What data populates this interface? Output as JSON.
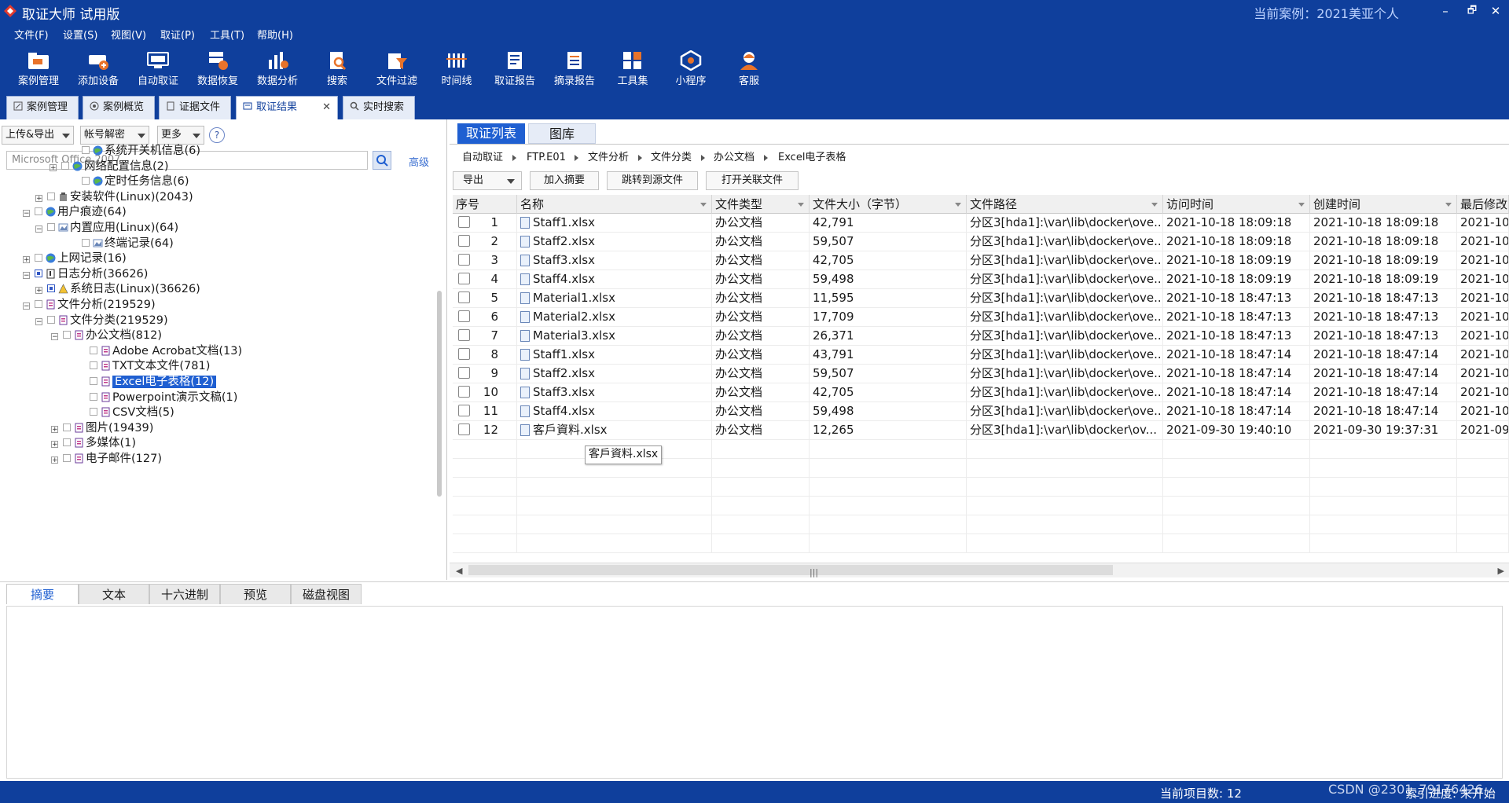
{
  "window": {
    "title": "取证大师 试用版",
    "case_label": "当前案例：2021美亚个人",
    "controls": {
      "minimize": "–",
      "restore": "🗗",
      "close": "✕"
    }
  },
  "menu": [
    "文件(F)",
    "设置(S)",
    "视图(V)",
    "取证(P)",
    "工具(T)",
    "帮助(H)"
  ],
  "toolbar": [
    {
      "label": "案例管理",
      "icon": "folder-icon"
    },
    {
      "label": "添加设备",
      "icon": "add-device-icon"
    },
    {
      "label": "自动取证",
      "icon": "auto-icon"
    },
    {
      "label": "数据恢复",
      "icon": "recover-icon"
    },
    {
      "label": "数据分析",
      "icon": "analysis-icon"
    },
    {
      "label": "搜索",
      "icon": "search-icon"
    },
    {
      "label": "文件过滤",
      "icon": "filter-icon"
    },
    {
      "label": "时间线",
      "icon": "timeline-icon"
    },
    {
      "label": "取证报告",
      "icon": "report-icon"
    },
    {
      "label": "摘录报告",
      "icon": "excerpt-report-icon"
    },
    {
      "label": "工具集",
      "icon": "toolset-icon"
    },
    {
      "label": "小程序",
      "icon": "miniapp-icon"
    },
    {
      "label": "客服",
      "icon": "support-icon"
    }
  ],
  "module_tabs": [
    {
      "label": "案例管理"
    },
    {
      "label": "案例概览"
    },
    {
      "label": "证据文件"
    },
    {
      "label": "取证结果",
      "active": true,
      "close": "✕"
    },
    {
      "label": "实时搜索"
    }
  ],
  "left": {
    "dropdowns": [
      "上传&导出",
      "帐号解密",
      "更多"
    ],
    "help": "?",
    "search_value": "Microsoft Office 2007",
    "advanced": "高级",
    "tree": [
      {
        "label": "系统开关机信息(6)"
      },
      {
        "label": "网络配置信息(2)",
        "expander": "+"
      },
      {
        "label": "定时任务信息(6)"
      },
      {
        "label": "安装软件(Linux)(2043)",
        "expander": "+"
      },
      {
        "label": "用户痕迹(64)",
        "expander": "−"
      },
      {
        "label": "内置应用(Linux)(64)",
        "expander": "−"
      },
      {
        "label": "终端记录(64)"
      },
      {
        "label": "上网记录(16)",
        "expander": "+"
      },
      {
        "label": "日志分析(36626)",
        "expander": "−"
      },
      {
        "label": "系统日志(Linux)(36626)",
        "expander": "+"
      },
      {
        "label": "文件分析(219529)",
        "expander": "−"
      },
      {
        "label": "文件分类(219529)",
        "expander": "−"
      },
      {
        "label": "办公文档(812)",
        "expander": "−"
      },
      {
        "label": "Adobe Acrobat文档(13)"
      },
      {
        "label": "TXT文本文件(781)"
      },
      {
        "label": "Excel电子表格(12)",
        "selected": true
      },
      {
        "label": "Powerpoint演示文稿(1)"
      },
      {
        "label": "CSV文档(5)"
      },
      {
        "label": "图片(19439)",
        "expander": "+"
      },
      {
        "label": "多媒体(1)",
        "expander": "+"
      },
      {
        "label": "电子邮件(127)",
        "expander": "+"
      }
    ]
  },
  "right": {
    "tabs": [
      {
        "label": "取证列表",
        "active": true
      },
      {
        "label": "图库"
      }
    ],
    "breadcrumb": [
      "自动取证",
      "FTP.E01",
      "文件分析",
      "文件分类",
      "办公文档",
      "Excel电子表格"
    ],
    "actions": {
      "export": "导出",
      "add_excerpt": "加入摘要",
      "jump_source": "跳转到源文件",
      "open_related": "打开关联文件"
    },
    "columns": [
      "序号",
      "名称",
      "文件类型",
      "文件大小（字节）",
      "文件路径",
      "访问时间",
      "创建时间",
      "最后修改"
    ],
    "rows": [
      [
        "1",
        "Staff1.xlsx",
        "办公文档",
        "42,791",
        "分区3[hda1]:\\var\\lib\\docker\\ove...",
        "2021-10-18 18:09:18",
        "2021-10-18 18:09:18",
        "2021-10-"
      ],
      [
        "2",
        "Staff2.xlsx",
        "办公文档",
        "59,507",
        "分区3[hda1]:\\var\\lib\\docker\\ove...",
        "2021-10-18 18:09:18",
        "2021-10-18 18:09:18",
        "2021-10-"
      ],
      [
        "3",
        "Staff3.xlsx",
        "办公文档",
        "42,705",
        "分区3[hda1]:\\var\\lib\\docker\\ove...",
        "2021-10-18 18:09:19",
        "2021-10-18 18:09:19",
        "2021-10-"
      ],
      [
        "4",
        "Staff4.xlsx",
        "办公文档",
        "59,498",
        "分区3[hda1]:\\var\\lib\\docker\\ove...",
        "2021-10-18 18:09:19",
        "2021-10-18 18:09:19",
        "2021-10-"
      ],
      [
        "5",
        "Material1.xlsx",
        "办公文档",
        "11,595",
        "分区3[hda1]:\\var\\lib\\docker\\ove...",
        "2021-10-18 18:47:13",
        "2021-10-18 18:47:13",
        "2021-10-"
      ],
      [
        "6",
        "Material2.xlsx",
        "办公文档",
        "17,709",
        "分区3[hda1]:\\var\\lib\\docker\\ove...",
        "2021-10-18 18:47:13",
        "2021-10-18 18:47:13",
        "2021-10-"
      ],
      [
        "7",
        "Material3.xlsx",
        "办公文档",
        "26,371",
        "分区3[hda1]:\\var\\lib\\docker\\ove...",
        "2021-10-18 18:47:13",
        "2021-10-18 18:47:13",
        "2021-10-"
      ],
      [
        "8",
        "Staff1.xlsx",
        "办公文档",
        "43,791",
        "分区3[hda1]:\\var\\lib\\docker\\ove...",
        "2021-10-18 18:47:14",
        "2021-10-18 18:47:14",
        "2021-10-"
      ],
      [
        "9",
        "Staff2.xlsx",
        "办公文档",
        "59,507",
        "分区3[hda1]:\\var\\lib\\docker\\ove...",
        "2021-10-18 18:47:14",
        "2021-10-18 18:47:14",
        "2021-10-"
      ],
      [
        "10",
        "Staff3.xlsx",
        "办公文档",
        "42,705",
        "分区3[hda1]:\\var\\lib\\docker\\ove...",
        "2021-10-18 18:47:14",
        "2021-10-18 18:47:14",
        "2021-10-"
      ],
      [
        "11",
        "Staff4.xlsx",
        "办公文档",
        "59,498",
        "分区3[hda1]:\\var\\lib\\docker\\ove...",
        "2021-10-18 18:47:14",
        "2021-10-18 18:47:14",
        "2021-10-"
      ],
      [
        "12",
        "客戶資料.xlsx",
        "办公文档",
        "12,265",
        "分区3[hda1]:\\var\\lib\\docker\\ov...",
        "2021-09-30 19:40:10",
        "2021-09-30 19:37:31",
        "2021-09-"
      ]
    ],
    "tooltip": "客戶資料.xlsx"
  },
  "bottom_tabs": [
    {
      "label": "摘要",
      "active": true
    },
    {
      "label": "文本"
    },
    {
      "label": "十六进制"
    },
    {
      "label": "预览"
    },
    {
      "label": "磁盘视图"
    }
  ],
  "status": {
    "count": "当前项目数: 12",
    "index": "索引进度: 未开始",
    "watermark": "CSDN @2301_79176426"
  },
  "colors": {
    "primary": "#0f3f9c",
    "accent": "#1f5fd1"
  }
}
